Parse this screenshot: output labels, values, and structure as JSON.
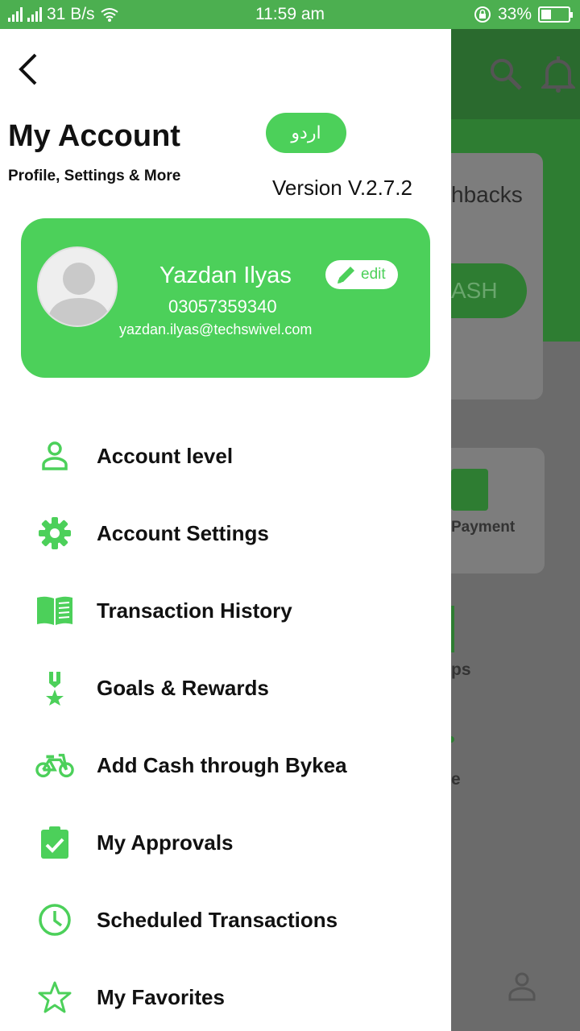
{
  "status_bar": {
    "network_speed": "31 B/s",
    "time": "11:59 am",
    "battery": "33%"
  },
  "background_app": {
    "card_text": "hbacks",
    "button_text": "ASH",
    "payment_text": "Payment",
    "partial_text_1": "ps",
    "partial_text_2": "e"
  },
  "drawer": {
    "title": "My Account",
    "subtitle": "Profile, Settings & More",
    "language_button": "اردو",
    "version": "Version V.2.7.2",
    "profile": {
      "name": "Yazdan Ilyas",
      "phone": "03057359340",
      "email": "yazdan.ilyas@techswivel.com",
      "edit_label": "edit"
    },
    "menu": [
      {
        "label": "Account level",
        "icon": "person-icon"
      },
      {
        "label": "Account Settings",
        "icon": "gear-icon"
      },
      {
        "label": "Transaction History",
        "icon": "book-icon"
      },
      {
        "label": "Goals & Rewards",
        "icon": "medal-icon"
      },
      {
        "label": "Add Cash through Bykea",
        "icon": "bicycle-icon"
      },
      {
        "label": "My Approvals",
        "icon": "clipboard-check-icon"
      },
      {
        "label": "Scheduled Transactions",
        "icon": "clock-icon"
      },
      {
        "label": "My Favorites",
        "icon": "star-icon"
      }
    ]
  },
  "colors": {
    "accent": "#4cd05a",
    "status_bar": "#4caf50"
  }
}
